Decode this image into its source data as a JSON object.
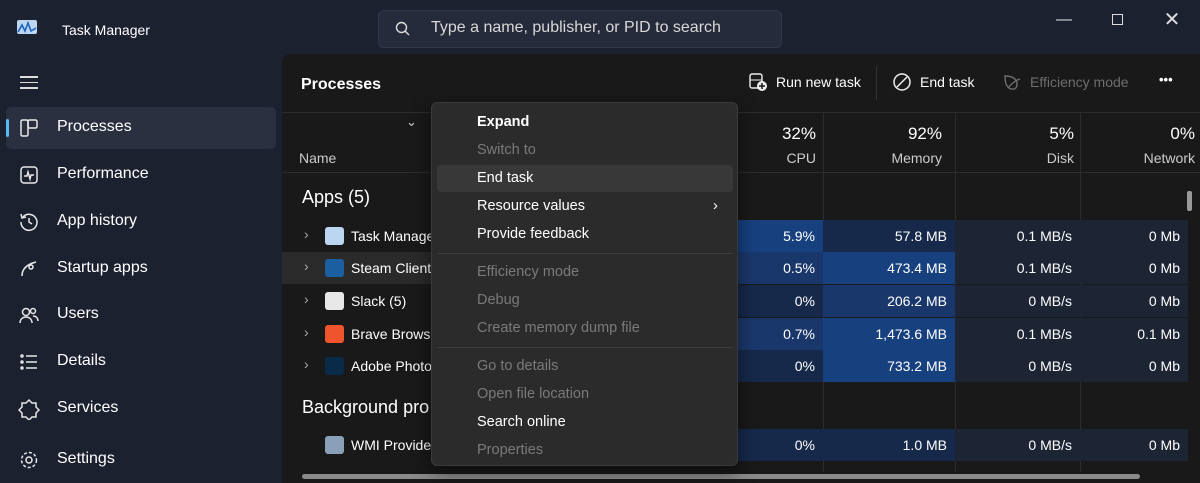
{
  "window": {
    "title": "Task Manager",
    "search_placeholder": "Type a name, publisher, or PID to search"
  },
  "sidebar": {
    "items": [
      {
        "label": "Processes",
        "icon": "processes-icon",
        "selected": true
      },
      {
        "label": "Performance",
        "icon": "performance-icon"
      },
      {
        "label": "App history",
        "icon": "history-icon"
      },
      {
        "label": "Startup apps",
        "icon": "startup-icon"
      },
      {
        "label": "Users",
        "icon": "users-icon"
      },
      {
        "label": "Details",
        "icon": "details-icon"
      },
      {
        "label": "Services",
        "icon": "services-icon"
      }
    ],
    "settings": "Settings"
  },
  "main": {
    "title": "Processes",
    "toolbar": {
      "run_new_task": "Run new task",
      "end_task": "End task",
      "efficiency_mode": "Efficiency mode",
      "more": "•••"
    },
    "columns": {
      "name": "Name",
      "cpu": {
        "pct": "32%",
        "label": "CPU"
      },
      "memory": {
        "pct": "92%",
        "label": "Memory"
      },
      "disk": {
        "pct": "5%",
        "label": "Disk"
      },
      "network": {
        "pct": "0%",
        "label": "Network"
      }
    },
    "groups": [
      {
        "label": "Apps (5)",
        "rows": [
          {
            "name": "Task Manage",
            "icon": "task-manager-icon",
            "color": "#bcd6f2",
            "cpu": "5.9%",
            "memory": "57.8 MB",
            "disk": "0.1 MB/s",
            "network": "0 Mb",
            "heat": [
              3,
              1,
              0,
              0
            ]
          },
          {
            "name": "Steam Client",
            "icon": "steam-icon",
            "color": "#1b5fa0",
            "cpu": "0.5%",
            "memory": "473.4 MB",
            "disk": "0.1 MB/s",
            "network": "0 Mb",
            "heat": [
              2,
              3,
              0,
              0
            ],
            "hover": true
          },
          {
            "name": "Slack (5)",
            "icon": "slack-icon",
            "color": "#e8e8e8",
            "cpu": "0%",
            "memory": "206.2 MB",
            "disk": "0 MB/s",
            "network": "0 Mb",
            "heat": [
              1,
              2,
              0,
              0
            ]
          },
          {
            "name": "Brave Browse",
            "icon": "brave-icon",
            "color": "#f0542c",
            "cpu": "0.7%",
            "memory": "1,473.6 MB",
            "disk": "0.1 MB/s",
            "network": "0.1 Mb",
            "heat": [
              2,
              3,
              0,
              0
            ]
          },
          {
            "name": "Adobe Photo",
            "icon": "photoshop-icon",
            "color": "#0a2a4a",
            "cpu": "0%",
            "memory": "733.2 MB",
            "disk": "0 MB/s",
            "network": "0 Mb",
            "heat": [
              1,
              3,
              0,
              0
            ]
          }
        ]
      },
      {
        "label": "Background pro",
        "rows": [
          {
            "name": "WMI Provide",
            "icon": "wmi-icon",
            "color": "#8aa0b8",
            "cpu": "0%",
            "memory": "1.0 MB",
            "disk": "0 MB/s",
            "network": "0 Mb",
            "heat": [
              1,
              1,
              0,
              0
            ],
            "nochev": true
          }
        ]
      }
    ]
  },
  "context_menu": {
    "items": [
      {
        "label": "Expand",
        "bold": true
      },
      {
        "label": "Switch to",
        "disabled": true
      },
      {
        "label": "End task",
        "hover": true
      },
      {
        "label": "Resource values",
        "submenu": true
      },
      {
        "label": "Provide feedback"
      },
      {
        "sep": true
      },
      {
        "label": "Efficiency mode",
        "disabled": true
      },
      {
        "label": "Debug",
        "disabled": true
      },
      {
        "label": "Create memory dump file",
        "disabled": true
      },
      {
        "sep": true
      },
      {
        "label": "Go to details",
        "disabled": true
      },
      {
        "label": "Open file location",
        "disabled": true
      },
      {
        "label": "Search online"
      },
      {
        "label": "Properties",
        "disabled": true
      }
    ]
  },
  "colors": {
    "heat": [
      "#1d2535",
      "#16294a",
      "#1a376c",
      "#17407f"
    ],
    "accent": "#5cb8f0"
  }
}
